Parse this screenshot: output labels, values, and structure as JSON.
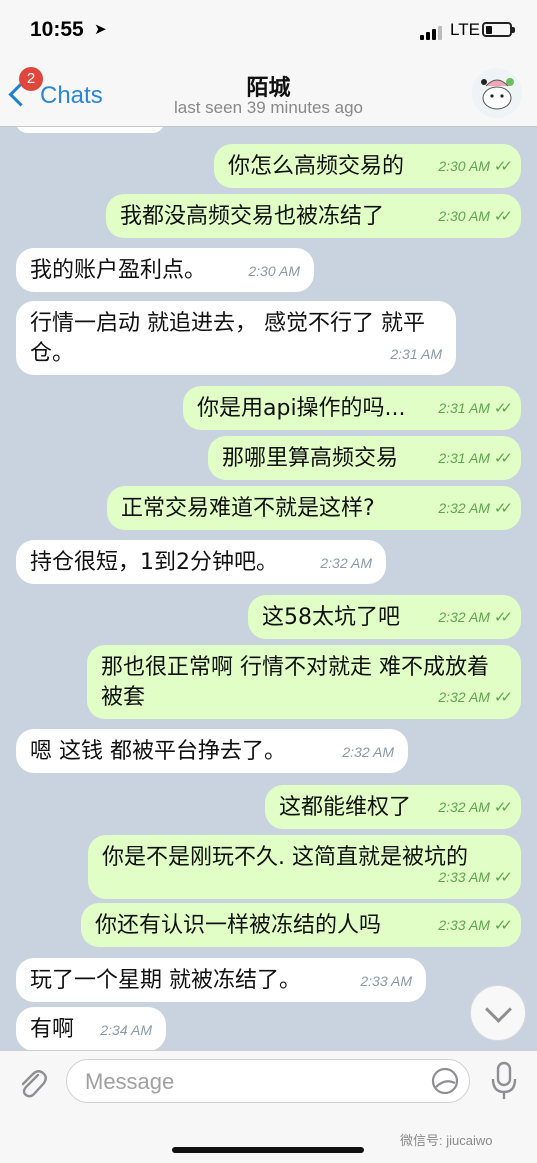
{
  "status": {
    "time": "10:55",
    "network": "LTE"
  },
  "nav": {
    "back_label": "Chats",
    "unread_badge": "2",
    "title": "陌城",
    "last_seen": "last seen 39 minutes ago"
  },
  "messages": [
    {
      "dir": "out",
      "text": "你怎么高频交易的",
      "time": "2:30 AM"
    },
    {
      "dir": "out",
      "text": "我都没高频交易也被冻结了",
      "time": "2:30 AM"
    },
    {
      "dir": "in",
      "text": "我的账户盈利点。",
      "time": "2:30 AM"
    },
    {
      "dir": "in",
      "text": "行情一启动 就追进去， 感觉不行了 就平仓。",
      "time": "2:31 AM"
    },
    {
      "dir": "out",
      "text": "你是用api操作的吗...",
      "time": "2:31 AM"
    },
    {
      "dir": "out",
      "text": "那哪里算高频交易",
      "time": "2:31 AM"
    },
    {
      "dir": "out",
      "text": "正常交易难道不就是这样?",
      "time": "2:32 AM"
    },
    {
      "dir": "in",
      "text": "持仓很短，1到2分钟吧。",
      "time": "2:32 AM"
    },
    {
      "dir": "out",
      "text": "这58太坑了吧",
      "time": "2:32 AM"
    },
    {
      "dir": "out",
      "text": "那也很正常啊 行情不对就走 难不成放着被套",
      "time": "2:32 AM"
    },
    {
      "dir": "in",
      "text": "嗯 这钱 都被平台挣去了。",
      "time": "2:32 AM"
    },
    {
      "dir": "out",
      "text": "这都能维权了",
      "time": "2:32 AM"
    },
    {
      "dir": "out",
      "text": "你是不是刚玩不久. 这简直就是被坑的",
      "time": "2:33 AM"
    },
    {
      "dir": "out",
      "text": "你还有认识一样被冻结的人吗",
      "time": "2:33 AM"
    },
    {
      "dir": "in",
      "text": "玩了一个星期 就被冻结了。",
      "time": "2:33 AM"
    },
    {
      "dir": "in",
      "text": "有啊",
      "time": "2:34 AM"
    }
  ],
  "input": {
    "placeholder": "Message"
  },
  "watermark": "微信号: jiucaiwo"
}
